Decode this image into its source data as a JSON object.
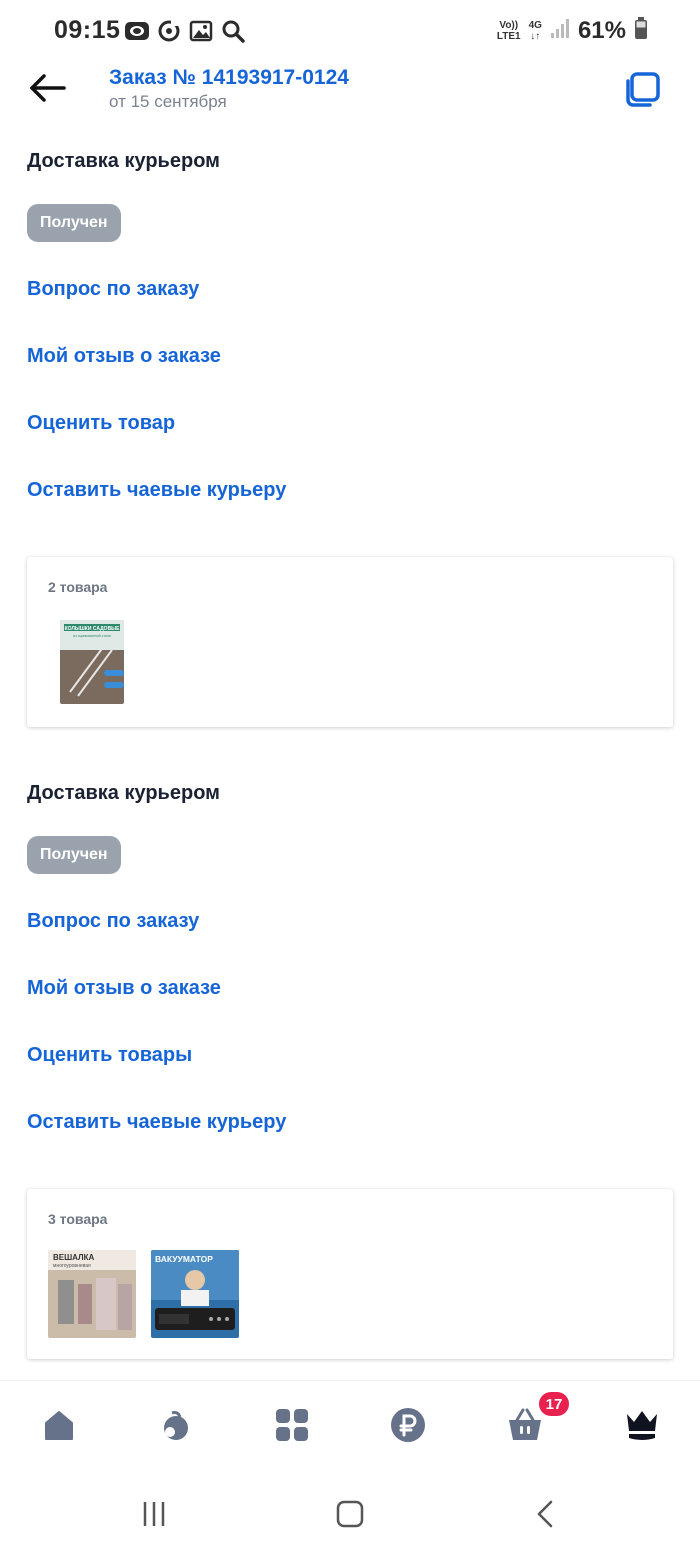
{
  "status_bar": {
    "time": "09:15",
    "network_top": "Vo))",
    "network_bottom": "LTE1",
    "network_type": "4G",
    "battery": "61%",
    "icons": [
      "camera-icon",
      "sync-icon",
      "gallery-icon",
      "search-icon",
      "signal-icon",
      "battery-icon"
    ]
  },
  "header": {
    "title": "Заказ № 14193917-0124",
    "subtitle": "от 15 сентября",
    "back_icon": "arrow-left-icon",
    "copy_icon": "copy-icon"
  },
  "sections": [
    {
      "title": "Доставка курьером",
      "status": "Получен",
      "links": [
        "Вопрос по заказу",
        "Мой отзыв о заказе",
        "Оценить товар",
        "Оставить чаевые курьеру"
      ],
      "items_count": "2 товара",
      "thumbnails": [
        {
          "caption_top": "КОЛЫШКИ САДОВЫЕ",
          "caption_mid": "из оцинкованной стали"
        }
      ]
    },
    {
      "title": "Доставка курьером",
      "status": "Получен",
      "links": [
        "Вопрос по заказу",
        "Мой отзыв о заказе",
        "Оценить товары",
        "Оставить чаевые курьеру"
      ],
      "items_count": "3 товара",
      "thumbnails": [
        {
          "caption_top": "ВЕШАЛКА",
          "caption_mid": "многоуровневая"
        },
        {
          "caption_top": "ВАКУУМАТОР",
          "caption_mid": ""
        }
      ]
    }
  ],
  "bottom_nav": {
    "items": [
      "home-icon",
      "fruit-icon",
      "catalog-icon",
      "ruble-icon",
      "cart-icon",
      "crown-icon"
    ],
    "cart_badge": "17"
  },
  "colors": {
    "accent": "#1565d8",
    "badge_bg": "#9aa2ad",
    "cart_badge": "#e8214f"
  }
}
